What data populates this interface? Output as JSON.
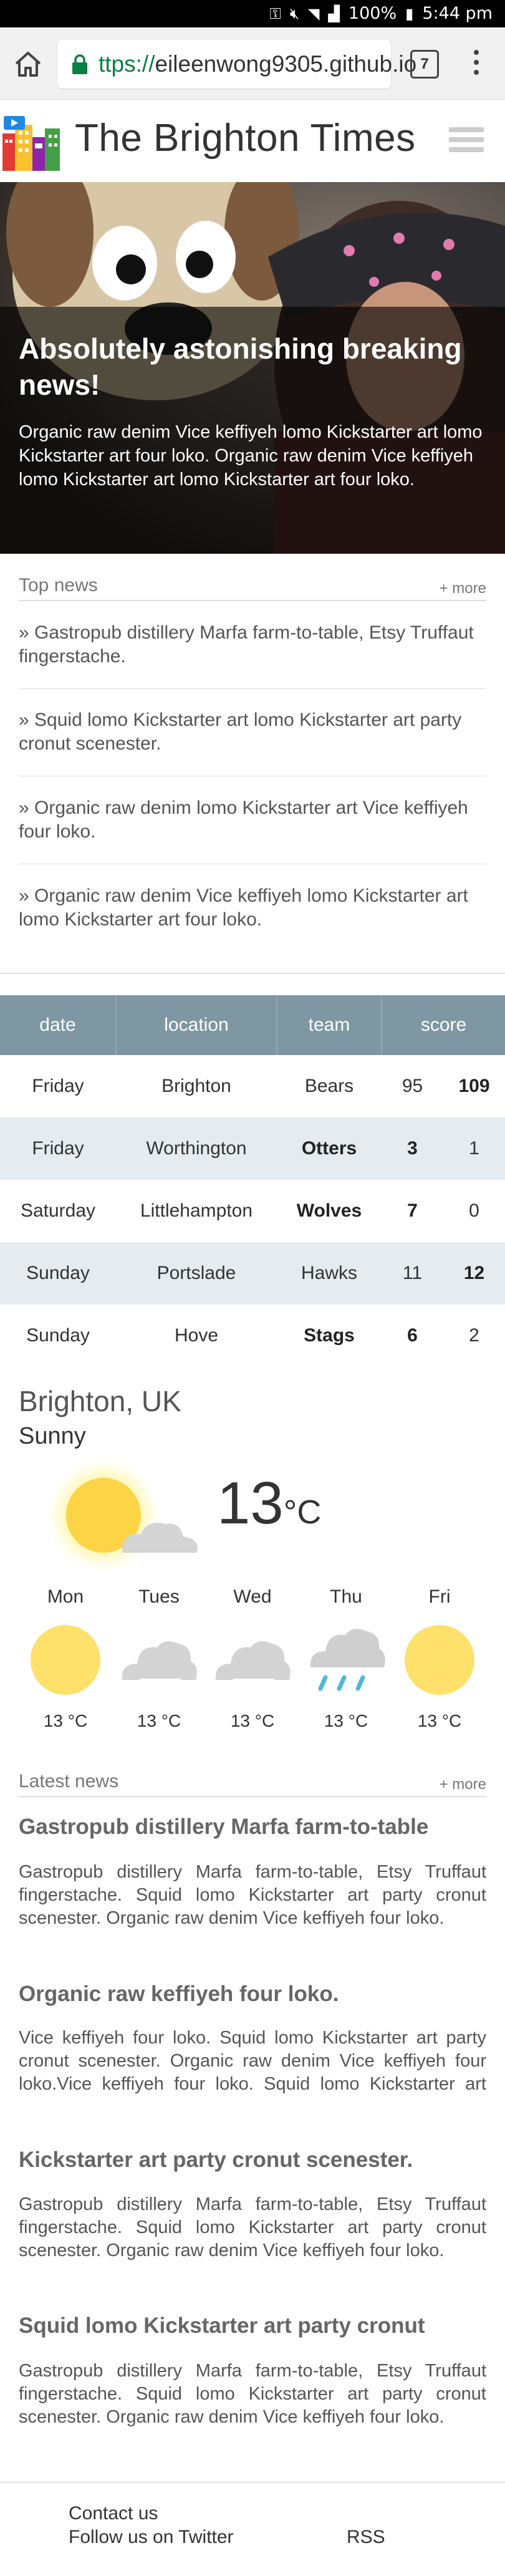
{
  "status_bar": {
    "battery": "100%",
    "time": "5:44 pm"
  },
  "browser": {
    "url_scheme": "ttps://",
    "url_host": "eileenwong9305.github.io",
    "tab_count": "7"
  },
  "site": {
    "title": "The Brighton Times"
  },
  "hero": {
    "title": "Absolutely astonishing breaking news!",
    "text": "Organic raw denim Vice keffiyeh lomo Kickstarter art lomo Kickstarter art four loko. Organic raw denim Vice keffiyeh lomo Kickstarter art lomo Kickstarter art four loko."
  },
  "top_news": {
    "label": "Top news",
    "more": "+ more",
    "items": [
      "» Gastropub distillery Marfa farm-to-table, Etsy Truffaut fingerstache.",
      "» Squid lomo Kickstarter art lomo Kickstarter art party cronut scenester.",
      "» Organic raw denim lomo Kickstarter art Vice keffiyeh four loko.",
      "» Organic raw denim Vice keffiyeh lomo Kickstarter art lomo Kickstarter art four loko."
    ]
  },
  "scores": {
    "headers": [
      "date",
      "location",
      "team",
      "score"
    ],
    "rows": [
      {
        "date": "Friday",
        "location": "Brighton",
        "team": "Bears",
        "home": "95",
        "away": "109"
      },
      {
        "date": "Friday",
        "location": "Worthington",
        "team": "Otters",
        "home": "3",
        "away": "1"
      },
      {
        "date": "Saturday",
        "location": "Littlehampton",
        "team": "Wolves",
        "home": "7",
        "away": "0"
      },
      {
        "date": "Sunday",
        "location": "Portslade",
        "team": "Hawks",
        "home": "11",
        "away": "12"
      },
      {
        "date": "Sunday",
        "location": "Hove",
        "team": "Stags",
        "home": "6",
        "away": "2"
      }
    ]
  },
  "weather": {
    "city": "Brighton, UK",
    "condition": "Sunny",
    "temp": "13",
    "unit": "°C",
    "forecast": [
      {
        "day": "Mon",
        "icon": "sun-icon",
        "temp": "13 °C"
      },
      {
        "day": "Tues",
        "icon": "cloud-icon",
        "temp": "13 °C"
      },
      {
        "day": "Wed",
        "icon": "cloud-icon",
        "temp": "13 °C"
      },
      {
        "day": "Thu",
        "icon": "rain-icon",
        "temp": "13 °C"
      },
      {
        "day": "Fri",
        "icon": "sun-icon",
        "temp": "13 °C"
      }
    ]
  },
  "latest_news": {
    "label": "Latest news",
    "more": "+ more",
    "articles": [
      {
        "title": "Gastropub distillery Marfa farm-to-table",
        "text": "Gastropub distillery Marfa farm-to-table, Etsy Truffaut fingerstache. Squid lomo Kickstarter art party cronut scenester. Organic raw denim Vice keffiyeh four loko."
      },
      {
        "title": "Organic raw keffiyeh four loko.",
        "text": "Vice keffiyeh four loko. Squid lomo Kickstarter art party cronut scenester. Organic raw denim Vice keffiyeh four loko.Vice keffiyeh four loko. Squid lomo Kickstarter art party cronut scenester."
      },
      {
        "title": "Kickstarter art party cronut scenester.",
        "text": "Gastropub distillery Marfa farm-to-table, Etsy Truffaut fingerstache. Squid lomo Kickstarter art party cronut scenester. Organic raw denim Vice keffiyeh four loko."
      },
      {
        "title": "Squid lomo Kickstarter art party cronut",
        "text": "Gastropub distillery Marfa farm-to-table, Etsy Truffaut fingerstache. Squid lomo Kickstarter art party cronut scenester. Organic raw denim Vice keffiyeh four loko."
      }
    ]
  },
  "footer": {
    "contact": "Contact us",
    "twitter": "Follow us on Twitter",
    "rss": "RSS"
  },
  "colors": {
    "table_header": "#7e97a3",
    "table_alt_row": "#e5ebee",
    "url_scheme": "#0b8043",
    "sun": "#fde16a"
  }
}
